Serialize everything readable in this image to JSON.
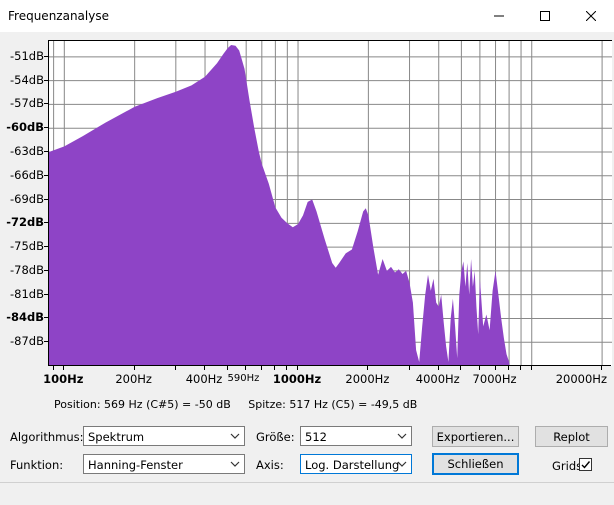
{
  "window": {
    "title": "Frequenzanalyse"
  },
  "chart_data": {
    "type": "area",
    "x_scale": "log",
    "y_ticks": [
      "-51dB",
      "-54dB",
      "-57dB",
      "-60dB",
      "-63dB",
      "-66dB",
      "-69dB",
      "-72dB",
      "-75dB",
      "-78dB",
      "-81dB",
      "-84dB",
      "-87dB"
    ],
    "bold_y_ticks": [
      "-60dB",
      "-72dB",
      "-84dB"
    ],
    "x_ticks": [
      {
        "label": "100Hz",
        "value": 100,
        "bold": true
      },
      {
        "label": "200Hz",
        "value": 200
      },
      {
        "label": "400Hz",
        "value": 400
      },
      {
        "label": "590Hz",
        "value": 590,
        "small": true
      },
      {
        "label": "1000Hz",
        "value": 1000,
        "bold": true
      },
      {
        "label": "2000Hz",
        "value": 2000
      },
      {
        "label": "4000Hz",
        "value": 4000
      },
      {
        "label": "7000Hz",
        "value": 7000
      },
      {
        "label": "20000Hz",
        "value": 20000
      }
    ],
    "x_range_hz": [
      86,
      22050
    ],
    "y_range_db": [
      -90,
      -49
    ],
    "grid": true,
    "fill_color": "#8e44c6",
    "series": [
      {
        "values": [
          [
            86,
            -63
          ],
          [
            100,
            -62.3
          ],
          [
            120,
            -61
          ],
          [
            150,
            -59.3
          ],
          [
            200,
            -57.3
          ],
          [
            250,
            -56.2
          ],
          [
            300,
            -55.4
          ],
          [
            350,
            -54.6
          ],
          [
            400,
            -53.5
          ],
          [
            450,
            -51.8
          ],
          [
            480,
            -50.6
          ],
          [
            500,
            -49.9
          ],
          [
            517,
            -49.5
          ],
          [
            540,
            -49.6
          ],
          [
            560,
            -50.2
          ],
          [
            590,
            -52.5
          ],
          [
            620,
            -56.5
          ],
          [
            650,
            -60
          ],
          [
            680,
            -63
          ],
          [
            700,
            -64.5
          ],
          [
            750,
            -67
          ],
          [
            800,
            -70
          ],
          [
            850,
            -71.3
          ],
          [
            900,
            -72
          ],
          [
            950,
            -72.5
          ],
          [
            1000,
            -72.1
          ],
          [
            1050,
            -71
          ],
          [
            1100,
            -69.3
          ],
          [
            1150,
            -69
          ],
          [
            1200,
            -70.5
          ],
          [
            1300,
            -74
          ],
          [
            1400,
            -77
          ],
          [
            1450,
            -77.6
          ],
          [
            1500,
            -77
          ],
          [
            1600,
            -75.8
          ],
          [
            1700,
            -75.3
          ],
          [
            1800,
            -73
          ],
          [
            1900,
            -70.5
          ],
          [
            1950,
            -70.1
          ],
          [
            2000,
            -71
          ],
          [
            2100,
            -75
          ],
          [
            2200,
            -78.5
          ],
          [
            2300,
            -76.5
          ],
          [
            2400,
            -78
          ],
          [
            2500,
            -77.5
          ],
          [
            2600,
            -78.2
          ],
          [
            2700,
            -77.8
          ],
          [
            2800,
            -78.4
          ],
          [
            2900,
            -78
          ],
          [
            3000,
            -79.5
          ],
          [
            3100,
            -82
          ],
          [
            3200,
            -88
          ],
          [
            3300,
            -89.5
          ],
          [
            3400,
            -85
          ],
          [
            3500,
            -81
          ],
          [
            3600,
            -78.5
          ],
          [
            3700,
            -80.5
          ],
          [
            3800,
            -79
          ],
          [
            3900,
            -82
          ],
          [
            4000,
            -82.5
          ],
          [
            4100,
            -81
          ],
          [
            4200,
            -84.5
          ],
          [
            4300,
            -87.5
          ],
          [
            4400,
            -89.5
          ],
          [
            4500,
            -84
          ],
          [
            4600,
            -81.5
          ],
          [
            4700,
            -85
          ],
          [
            4800,
            -89
          ],
          [
            4900,
            -81
          ],
          [
            5000,
            -78
          ],
          [
            5100,
            -76.8
          ],
          [
            5200,
            -80
          ],
          [
            5300,
            -77
          ],
          [
            5400,
            -81
          ],
          [
            5500,
            -76.5
          ],
          [
            5600,
            -80
          ],
          [
            5700,
            -78
          ],
          [
            5800,
            -82.5
          ],
          [
            5900,
            -86
          ],
          [
            6000,
            -79
          ],
          [
            6200,
            -85
          ],
          [
            6400,
            -83.5
          ],
          [
            6600,
            -85.5
          ],
          [
            6800,
            -80.5
          ],
          [
            7000,
            -78
          ],
          [
            7200,
            -81
          ],
          [
            7400,
            -84
          ],
          [
            7600,
            -86.5
          ],
          [
            7800,
            -88.5
          ],
          [
            8000,
            -89.5
          ],
          [
            8100,
            -91
          ]
        ]
      }
    ]
  },
  "status": {
    "position": "Position: 569 Hz (C#5) = -50 dB",
    "peak": "Spitze: 517 Hz (C5) = -49,5 dB"
  },
  "controls": {
    "algorithm_label": "Algorithmus:",
    "algorithm_value": "Spektrum",
    "size_label": "Größe:",
    "size_value": "512",
    "export_label": "Exportieren...",
    "replot_label": "Replot",
    "function_label": "Funktion:",
    "function_value": "Hanning-Fenster",
    "axis_label": "Axis:",
    "axis_value": "Log. Darstellung",
    "close_label": "Schließen",
    "grids_label": "Grids"
  }
}
